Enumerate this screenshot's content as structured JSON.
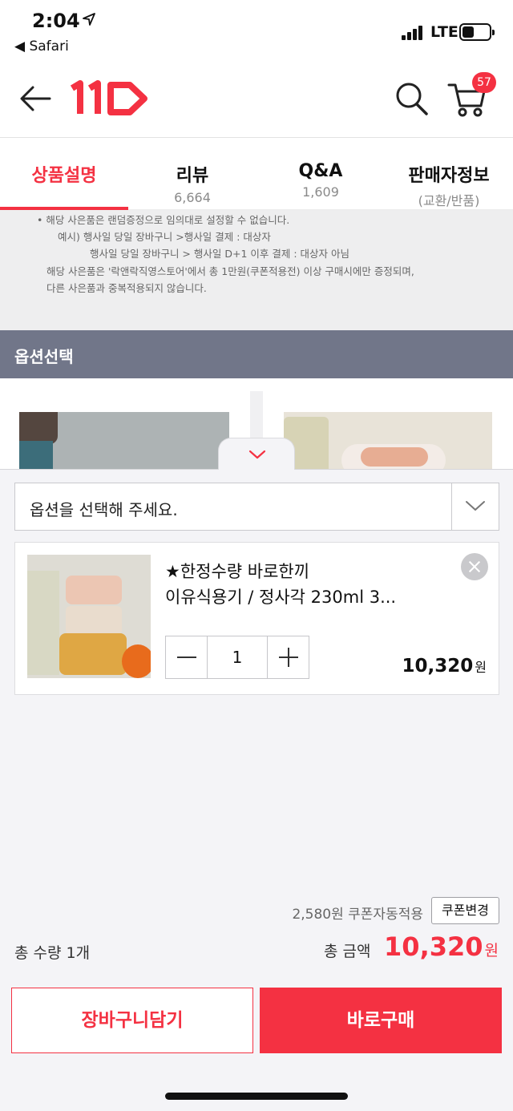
{
  "status_bar": {
    "time": "2:04",
    "location_icon": "location-arrow-icon",
    "back_app": "◀ Safari",
    "carrier": "LTE"
  },
  "header": {
    "logo_text": "11",
    "cart_badge": "57",
    "icons": [
      "back-arrow-icon",
      "search-icon",
      "cart-icon"
    ]
  },
  "tabs": [
    {
      "label": "상품설명",
      "sub": ""
    },
    {
      "label": "리뷰",
      "sub": "6,664"
    },
    {
      "label": "Q&A",
      "sub": "1,609"
    },
    {
      "label": "판매자정보",
      "sub": "(교환/반품)"
    }
  ],
  "notice": {
    "line1": "•  해당 사은품은 랜덤증정으로 임의대로 설정할 수 없습니다.",
    "line2": "예시)  행사일 당일 장바구니 >행사일 결제 : 대상자",
    "line3": "행사일 당일 장바구니 > 행사일 D+1 이후 결제 : 대상자 아님",
    "line4": "해당 사은품은 '락앤락직영스토어'에서 총 1만원(쿠폰적용전) 이상 구매시에만 증정되며,",
    "line5": "다른 사은품과 중복적용되지 않습니다."
  },
  "option_section": {
    "title": "옵션선택"
  },
  "option_select": {
    "placeholder": "옵션을 선택해 주세요."
  },
  "selected_item": {
    "title_line1": "★한정수량 바로한끼",
    "title_line2": "이유식용기 / 정사각 230ml 3...",
    "quantity": "1",
    "price": "10,320",
    "currency": "원"
  },
  "summary": {
    "coupon_text": "2,580원 쿠폰자동적용",
    "coupon_button": "쿠폰변경",
    "total_qty": "총 수량 1개",
    "total_label": "총 금액",
    "total_price": "10,320",
    "currency": "원"
  },
  "actions": {
    "add_to_cart": "장바구니담기",
    "buy_now": "바로구매"
  },
  "colors": {
    "accent": "#f43142",
    "option_bar": "#717689",
    "sheet_bg": "#f4f4f7"
  }
}
